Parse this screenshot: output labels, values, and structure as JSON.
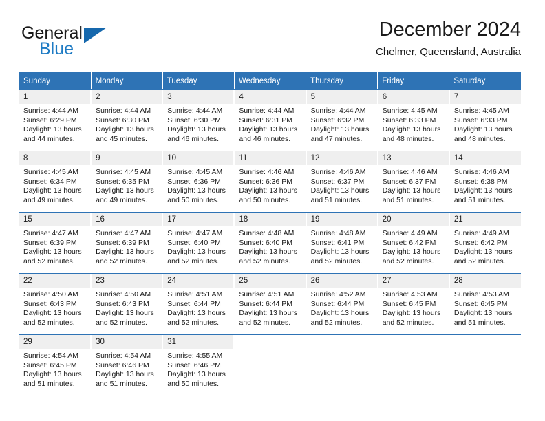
{
  "brand": {
    "name_part1": "General",
    "name_part2": "Blue",
    "color_dark": "#1a1a1a",
    "color_blue": "#1e7bc4"
  },
  "header": {
    "title": "December 2024",
    "subtitle": "Chelmer, Queensland, Australia"
  },
  "theme": {
    "header_bg": "#2e73b5",
    "header_text": "#ffffff",
    "daynum_bg": "#efefef",
    "cell_bg": "#ffffff",
    "text": "#1a1a1a"
  },
  "weekday_headers": [
    "Sunday",
    "Monday",
    "Tuesday",
    "Wednesday",
    "Thursday",
    "Friday",
    "Saturday"
  ],
  "weeks": [
    [
      {
        "day": "1",
        "sunrise": "Sunrise: 4:44 AM",
        "sunset": "Sunset: 6:29 PM",
        "daylight1": "Daylight: 13 hours",
        "daylight2": "and 44 minutes."
      },
      {
        "day": "2",
        "sunrise": "Sunrise: 4:44 AM",
        "sunset": "Sunset: 6:30 PM",
        "daylight1": "Daylight: 13 hours",
        "daylight2": "and 45 minutes."
      },
      {
        "day": "3",
        "sunrise": "Sunrise: 4:44 AM",
        "sunset": "Sunset: 6:30 PM",
        "daylight1": "Daylight: 13 hours",
        "daylight2": "and 46 minutes."
      },
      {
        "day": "4",
        "sunrise": "Sunrise: 4:44 AM",
        "sunset": "Sunset: 6:31 PM",
        "daylight1": "Daylight: 13 hours",
        "daylight2": "and 46 minutes."
      },
      {
        "day": "5",
        "sunrise": "Sunrise: 4:44 AM",
        "sunset": "Sunset: 6:32 PM",
        "daylight1": "Daylight: 13 hours",
        "daylight2": "and 47 minutes."
      },
      {
        "day": "6",
        "sunrise": "Sunrise: 4:45 AM",
        "sunset": "Sunset: 6:33 PM",
        "daylight1": "Daylight: 13 hours",
        "daylight2": "and 48 minutes."
      },
      {
        "day": "7",
        "sunrise": "Sunrise: 4:45 AM",
        "sunset": "Sunset: 6:33 PM",
        "daylight1": "Daylight: 13 hours",
        "daylight2": "and 48 minutes."
      }
    ],
    [
      {
        "day": "8",
        "sunrise": "Sunrise: 4:45 AM",
        "sunset": "Sunset: 6:34 PM",
        "daylight1": "Daylight: 13 hours",
        "daylight2": "and 49 minutes."
      },
      {
        "day": "9",
        "sunrise": "Sunrise: 4:45 AM",
        "sunset": "Sunset: 6:35 PM",
        "daylight1": "Daylight: 13 hours",
        "daylight2": "and 49 minutes."
      },
      {
        "day": "10",
        "sunrise": "Sunrise: 4:45 AM",
        "sunset": "Sunset: 6:36 PM",
        "daylight1": "Daylight: 13 hours",
        "daylight2": "and 50 minutes."
      },
      {
        "day": "11",
        "sunrise": "Sunrise: 4:46 AM",
        "sunset": "Sunset: 6:36 PM",
        "daylight1": "Daylight: 13 hours",
        "daylight2": "and 50 minutes."
      },
      {
        "day": "12",
        "sunrise": "Sunrise: 4:46 AM",
        "sunset": "Sunset: 6:37 PM",
        "daylight1": "Daylight: 13 hours",
        "daylight2": "and 51 minutes."
      },
      {
        "day": "13",
        "sunrise": "Sunrise: 4:46 AM",
        "sunset": "Sunset: 6:37 PM",
        "daylight1": "Daylight: 13 hours",
        "daylight2": "and 51 minutes."
      },
      {
        "day": "14",
        "sunrise": "Sunrise: 4:46 AM",
        "sunset": "Sunset: 6:38 PM",
        "daylight1": "Daylight: 13 hours",
        "daylight2": "and 51 minutes."
      }
    ],
    [
      {
        "day": "15",
        "sunrise": "Sunrise: 4:47 AM",
        "sunset": "Sunset: 6:39 PM",
        "daylight1": "Daylight: 13 hours",
        "daylight2": "and 52 minutes."
      },
      {
        "day": "16",
        "sunrise": "Sunrise: 4:47 AM",
        "sunset": "Sunset: 6:39 PM",
        "daylight1": "Daylight: 13 hours",
        "daylight2": "and 52 minutes."
      },
      {
        "day": "17",
        "sunrise": "Sunrise: 4:47 AM",
        "sunset": "Sunset: 6:40 PM",
        "daylight1": "Daylight: 13 hours",
        "daylight2": "and 52 minutes."
      },
      {
        "day": "18",
        "sunrise": "Sunrise: 4:48 AM",
        "sunset": "Sunset: 6:40 PM",
        "daylight1": "Daylight: 13 hours",
        "daylight2": "and 52 minutes."
      },
      {
        "day": "19",
        "sunrise": "Sunrise: 4:48 AM",
        "sunset": "Sunset: 6:41 PM",
        "daylight1": "Daylight: 13 hours",
        "daylight2": "and 52 minutes."
      },
      {
        "day": "20",
        "sunrise": "Sunrise: 4:49 AM",
        "sunset": "Sunset: 6:42 PM",
        "daylight1": "Daylight: 13 hours",
        "daylight2": "and 52 minutes."
      },
      {
        "day": "21",
        "sunrise": "Sunrise: 4:49 AM",
        "sunset": "Sunset: 6:42 PM",
        "daylight1": "Daylight: 13 hours",
        "daylight2": "and 52 minutes."
      }
    ],
    [
      {
        "day": "22",
        "sunrise": "Sunrise: 4:50 AM",
        "sunset": "Sunset: 6:43 PM",
        "daylight1": "Daylight: 13 hours",
        "daylight2": "and 52 minutes."
      },
      {
        "day": "23",
        "sunrise": "Sunrise: 4:50 AM",
        "sunset": "Sunset: 6:43 PM",
        "daylight1": "Daylight: 13 hours",
        "daylight2": "and 52 minutes."
      },
      {
        "day": "24",
        "sunrise": "Sunrise: 4:51 AM",
        "sunset": "Sunset: 6:44 PM",
        "daylight1": "Daylight: 13 hours",
        "daylight2": "and 52 minutes."
      },
      {
        "day": "25",
        "sunrise": "Sunrise: 4:51 AM",
        "sunset": "Sunset: 6:44 PM",
        "daylight1": "Daylight: 13 hours",
        "daylight2": "and 52 minutes."
      },
      {
        "day": "26",
        "sunrise": "Sunrise: 4:52 AM",
        "sunset": "Sunset: 6:44 PM",
        "daylight1": "Daylight: 13 hours",
        "daylight2": "and 52 minutes."
      },
      {
        "day": "27",
        "sunrise": "Sunrise: 4:53 AM",
        "sunset": "Sunset: 6:45 PM",
        "daylight1": "Daylight: 13 hours",
        "daylight2": "and 52 minutes."
      },
      {
        "day": "28",
        "sunrise": "Sunrise: 4:53 AM",
        "sunset": "Sunset: 6:45 PM",
        "daylight1": "Daylight: 13 hours",
        "daylight2": "and 51 minutes."
      }
    ],
    [
      {
        "day": "29",
        "sunrise": "Sunrise: 4:54 AM",
        "sunset": "Sunset: 6:45 PM",
        "daylight1": "Daylight: 13 hours",
        "daylight2": "and 51 minutes."
      },
      {
        "day": "30",
        "sunrise": "Sunrise: 4:54 AM",
        "sunset": "Sunset: 6:46 PM",
        "daylight1": "Daylight: 13 hours",
        "daylight2": "and 51 minutes."
      },
      {
        "day": "31",
        "sunrise": "Sunrise: 4:55 AM",
        "sunset": "Sunset: 6:46 PM",
        "daylight1": "Daylight: 13 hours",
        "daylight2": "and 50 minutes."
      },
      {
        "day": "",
        "sunrise": "",
        "sunset": "",
        "daylight1": "",
        "daylight2": ""
      },
      {
        "day": "",
        "sunrise": "",
        "sunset": "",
        "daylight1": "",
        "daylight2": ""
      },
      {
        "day": "",
        "sunrise": "",
        "sunset": "",
        "daylight1": "",
        "daylight2": ""
      },
      {
        "day": "",
        "sunrise": "",
        "sunset": "",
        "daylight1": "",
        "daylight2": ""
      }
    ]
  ]
}
